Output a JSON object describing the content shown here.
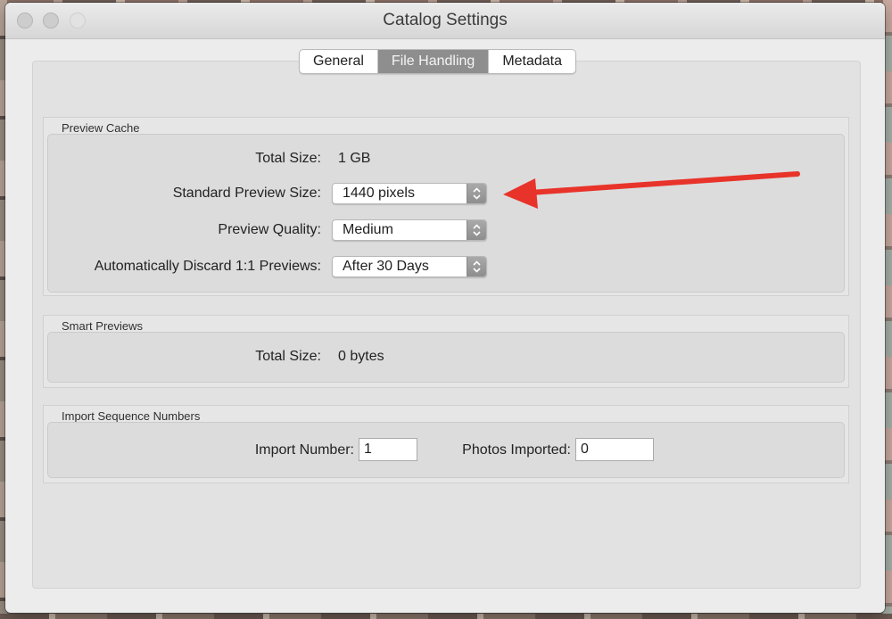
{
  "window": {
    "title": "Catalog Settings"
  },
  "tabs": [
    {
      "label": "General",
      "active": false
    },
    {
      "label": "File Handling",
      "active": true
    },
    {
      "label": "Metadata",
      "active": false
    }
  ],
  "preview_cache": {
    "title": "Preview Cache",
    "total_size_label": "Total Size:",
    "total_size_value": "1 GB",
    "standard_preview_size_label": "Standard Preview Size:",
    "standard_preview_size_value": "1440 pixels",
    "preview_quality_label": "Preview Quality:",
    "preview_quality_value": "Medium",
    "discard_label": "Automatically Discard 1:1 Previews:",
    "discard_value": "After 30 Days"
  },
  "smart_previews": {
    "title": "Smart Previews",
    "total_size_label": "Total Size:",
    "total_size_value": "0 bytes"
  },
  "import_sequence": {
    "title": "Import Sequence Numbers",
    "import_number_label": "Import Number:",
    "import_number_value": "1",
    "photos_imported_label": "Photos Imported:",
    "photos_imported_value": "0"
  },
  "colors": {
    "annotation_arrow": "#e8332a",
    "active_tab": "#8e8e8e"
  },
  "icons": {
    "popup_stepper": "chevron-up-down-icon",
    "annotation": "red-arrow-annotation"
  }
}
